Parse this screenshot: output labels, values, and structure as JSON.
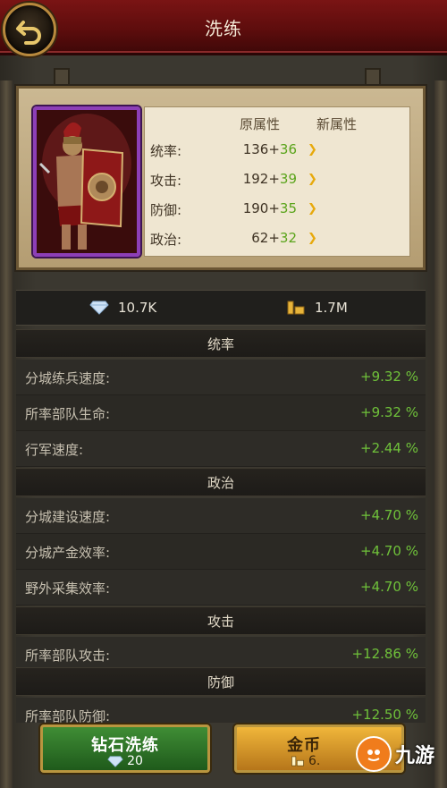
{
  "header": {
    "title": "洗练"
  },
  "hero": {
    "stat_headers": {
      "original": "原属性",
      "new": "新属性"
    },
    "stats": [
      {
        "name": "统率:",
        "base": "136+",
        "bonus": "36"
      },
      {
        "name": "攻击:",
        "base": "192+",
        "bonus": "39"
      },
      {
        "name": "防御:",
        "base": "190+",
        "bonus": "35"
      },
      {
        "name": "政治:",
        "base": "62+",
        "bonus": "32"
      }
    ]
  },
  "resources": {
    "diamonds": "10.7K",
    "gold": "1.7M"
  },
  "sections": [
    {
      "title": "统率",
      "rows": [
        {
          "label": "分城练兵速度:",
          "value": "+9.32 %"
        },
        {
          "label": "所率部队生命:",
          "value": "+9.32 %"
        },
        {
          "label": "行军速度:",
          "value": "+2.44 %"
        }
      ]
    },
    {
      "title": "政治",
      "rows": [
        {
          "label": "分城建设速度:",
          "value": "+4.70 %"
        },
        {
          "label": "分城产金效率:",
          "value": "+4.70 %"
        },
        {
          "label": "野外采集效率:",
          "value": "+4.70 %"
        }
      ]
    },
    {
      "title": "攻击",
      "rows": [
        {
          "label": "所率部队攻击:",
          "value": "+12.86 %"
        }
      ]
    },
    {
      "title": "防御",
      "rows": [
        {
          "label": "所率部队防御:",
          "value": "+12.50 %"
        }
      ]
    }
  ],
  "buttons": {
    "diamond_refine": {
      "label": "钻石洗练",
      "cost": "20"
    },
    "gold_refine": {
      "label": "金币",
      "cost": "6."
    }
  },
  "watermark": {
    "text": "九游"
  },
  "colors": {
    "bonus_green": "#5aa41b",
    "purple_frame": "#8d3fb7",
    "header_red": "#7a1414"
  }
}
